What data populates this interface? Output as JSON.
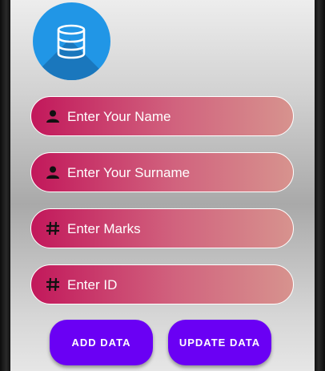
{
  "form": {
    "name_placeholder": "Enter Your Name",
    "surname_placeholder": "Enter Your Surname",
    "marks_placeholder": "Enter Marks",
    "id_placeholder": "Enter ID"
  },
  "actions": {
    "add_label": "ADD DATA",
    "update_label": "UPDATE DATA"
  },
  "icons": {
    "logo": "database-icon",
    "name": "person-icon",
    "surname": "person-icon",
    "marks": "hash-icon",
    "id": "hash-icon"
  },
  "colors": {
    "logo_bg": "#2196e6",
    "field_gradient_start": "#c2185b",
    "field_gradient_end": "#d7938e",
    "button_bg": "#6a00f4"
  }
}
